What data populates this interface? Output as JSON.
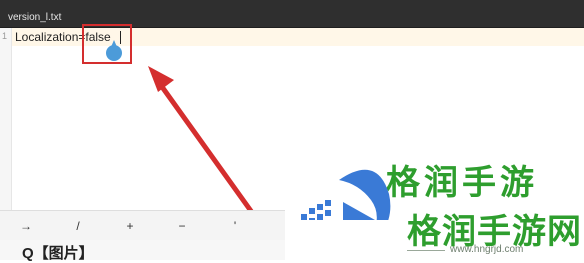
{
  "editor": {
    "tab_title": "version_l.txt",
    "line_number": "1",
    "line_text": "Localization=false"
  },
  "keyboard_row": {
    "keys": [
      "→",
      "/",
      "+",
      "−",
      "'"
    ]
  },
  "list_row": {
    "text": "Q【图片】"
  },
  "watermark": {
    "brand_top": "格润手游",
    "brand_text": "格润手游网",
    "url": "www.hngrjd.com"
  },
  "colors": {
    "highlight": "#d42e2e",
    "arrow": "#d42e2e",
    "brand_green": "#2e9e2e",
    "brand_blue": "#3a7ad6"
  }
}
